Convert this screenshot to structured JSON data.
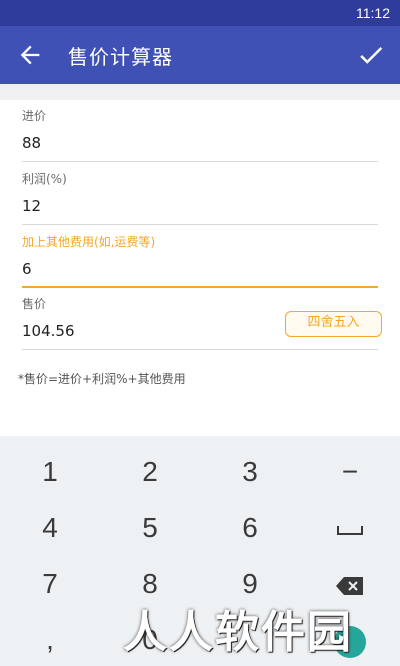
{
  "status_bar": {
    "time": "11:12"
  },
  "app_bar": {
    "title": "售价计算器"
  },
  "fields": {
    "cost": {
      "label": "进价",
      "value": "88"
    },
    "profit": {
      "label": "利润(%)",
      "value": "12"
    },
    "extra": {
      "label": "加上其他费用(如,运费等)",
      "value": "6"
    },
    "price": {
      "label": "售价",
      "value": "104.56"
    }
  },
  "round_button": {
    "label": "四舍五入"
  },
  "formula": "*售价=进价+利润%+其他费用",
  "keyboard": {
    "keys": [
      "1",
      "2",
      "3",
      "−",
      "4",
      "5",
      "6",
      "",
      "7",
      "8",
      "9",
      "",
      ",",
      "0",
      "",
      ""
    ]
  },
  "colors": {
    "primary": "#3f51b5",
    "status": "#2f3c9c",
    "accent": "#f5a623"
  },
  "icons": {
    "back": "arrow-left-icon",
    "confirm": "check-icon",
    "space": "space-icon",
    "backspace": "backspace-icon"
  },
  "watermark": "人人软件园"
}
